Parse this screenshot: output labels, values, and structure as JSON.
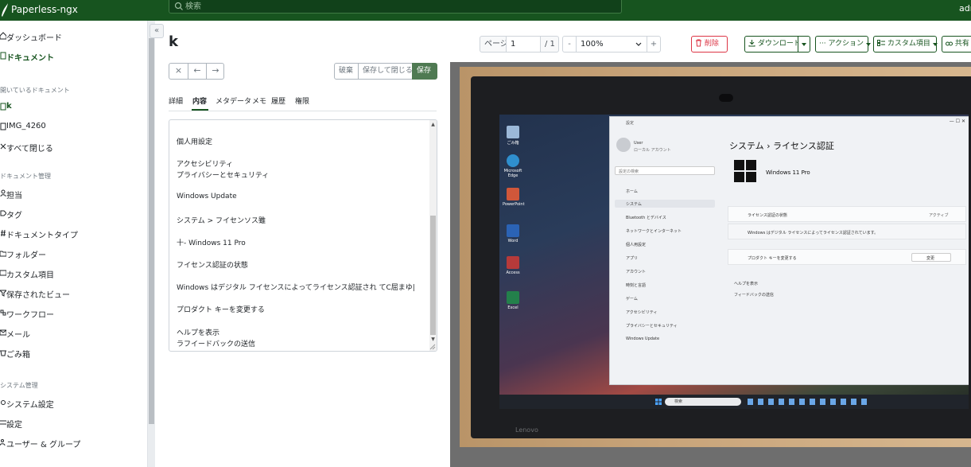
{
  "topbar": {
    "brand": "Paperless-ngx",
    "search_placeholder": "検索",
    "user": "admin"
  },
  "sidebar": {
    "main": [
      {
        "label": "ダッシュボード",
        "icon": "house-icon",
        "active": false
      },
      {
        "label": "ドキュメント",
        "icon": "file-icon",
        "active": true
      }
    ],
    "open_docs_heading": "開いているドキュメント",
    "open_docs": [
      {
        "label": "k",
        "icon": "file-icon",
        "active": true
      },
      {
        "label": "IMG_4260",
        "icon": "file-icon",
        "active": false
      },
      {
        "label": "すべて閉じる",
        "icon": "x-icon",
        "active": false
      }
    ],
    "manage_heading": "ドキュメント管理",
    "manage": [
      {
        "label": "担当",
        "icon": "person-icon"
      },
      {
        "label": "タグ",
        "icon": "tag-icon"
      },
      {
        "label": "ドキュメントタイプ",
        "icon": "hash-icon"
      },
      {
        "label": "フォルダー",
        "icon": "folder-icon"
      },
      {
        "label": "カスタム項目",
        "icon": "ui-radios-icon"
      },
      {
        "label": "保存されたビュー",
        "icon": "funnel-icon"
      },
      {
        "label": "ワークフロー",
        "icon": "boxes-icon"
      },
      {
        "label": "メール",
        "icon": "envelope-icon"
      },
      {
        "label": "ごみ箱",
        "icon": "trash-icon"
      }
    ],
    "admin_heading": "システム管理",
    "admin": [
      {
        "label": "システム設定",
        "icon": "gear-icon"
      },
      {
        "label": "設定",
        "icon": "sliders-icon"
      },
      {
        "label": "ユーザー & グループ",
        "icon": "people-icon"
      }
    ]
  },
  "document": {
    "title": "k"
  },
  "pager": {
    "page_label": "ページ",
    "page_value": "1",
    "of": "/ 1",
    "minus": "-",
    "zoom": "100%",
    "plus": "+"
  },
  "actions": {
    "delete": "削除",
    "download": "ダウンロード",
    "actions": "アクション",
    "custom_fields": "カスタム項目",
    "share": "共有"
  },
  "editor_toolbar": {
    "close": "×",
    "prev": "←",
    "next": "→",
    "discard": "破棄",
    "save_close": "保存して閉じる",
    "save": "保存"
  },
  "tabs": [
    "詳細",
    "内容",
    "メタデータ",
    "メモ",
    "履歴",
    "権限"
  ],
  "content_lines": [
    "個人用設定",
    "アクセシビリティ",
    "プライバシーとセキュリティ",
    "Windows Update",
    "システム > フイセンソス雖",
    "十- Windows 11 Pro",
    "フイセンス認証の状態",
    "Windows はデジタル フイセンスによってライセンス認証され てC屈まゆ|",
    "プロダクト キーを変更する",
    "ヘルプを表示",
    "ラフイードバックの送信"
  ],
  "preview": {
    "settings_title": "設定",
    "user_name": "User",
    "user_sub": "ローカル アカウント",
    "search_settings": "設定の検索",
    "nav": [
      "ホーム",
      "システム",
      "Bluetooth とデバイス",
      "ネットワークとインターネット",
      "個人用設定",
      "アプリ",
      "アカウント",
      "時刻と言語",
      "ゲーム",
      "アクセシビリティ",
      "プライバシーとセキュリティ",
      "Windows Update"
    ],
    "breadcrumb": "システム  ›  ライセンス認証",
    "edition": "Windows 11 Pro",
    "state_label": "ライセンス認証の状態",
    "state_value": "アクティブ",
    "state_text": "Windows はデジタル ライセンスによってライセンス認証されています。",
    "change_key": "プロダクト キーを変更する",
    "change_btn": "変更",
    "help": "ヘルプを表示",
    "feedback": "フィードバックの送信",
    "desktop_icons": [
      "ごみ箱",
      "Microsoft Edge",
      "PowerPoint",
      "Word",
      "Access",
      "Excel"
    ],
    "taskbar_search": "検索",
    "brand": "Lenovo"
  }
}
